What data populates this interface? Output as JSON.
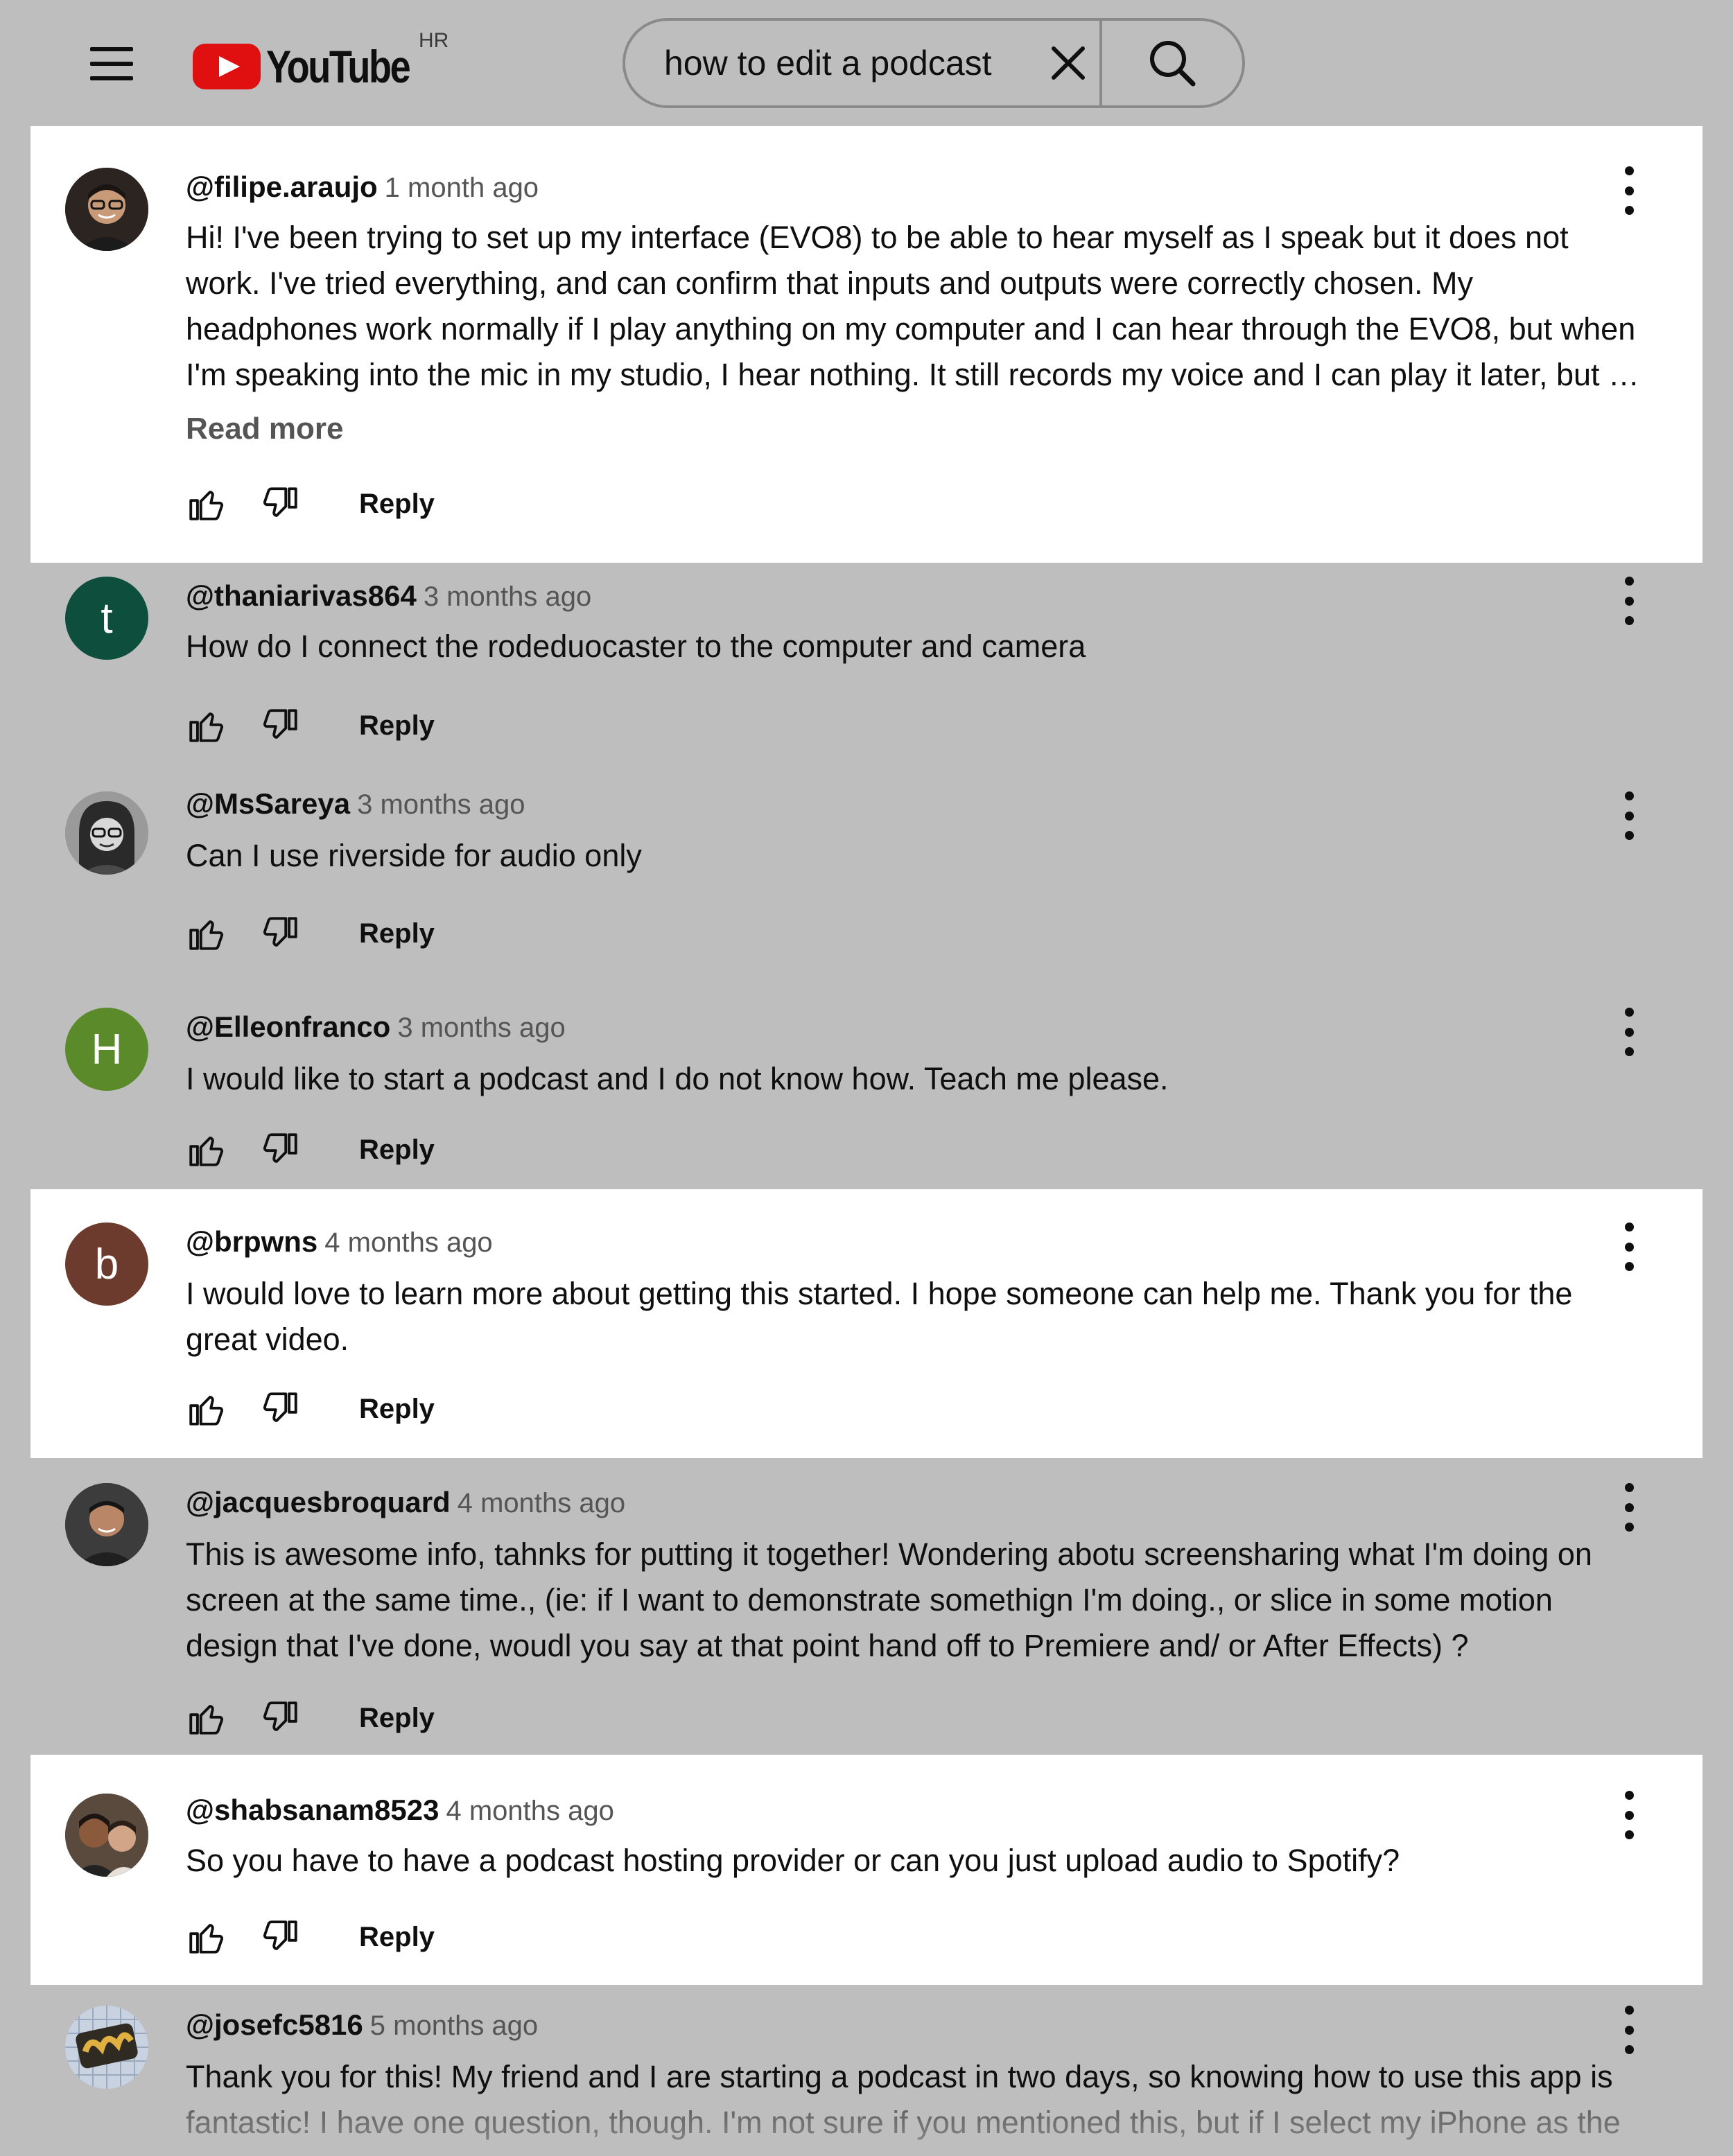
{
  "header": {
    "logo_text": "YouTube",
    "country_code": "HR",
    "search_query": "how to edit a podcast"
  },
  "comments": [
    {
      "author": "@filipe.araujo",
      "time": "1 month ago",
      "lines": [
        "Hi! I've been trying to set up my interface (EVO8) to be able to hear myself as I speak but it does not",
        "work. I've tried everything, and can confirm that inputs and outputs were correctly chosen. My",
        "headphones work normally if I play anything on my computer and I can hear through the EVO8, but when",
        "I'm speaking into the mic in my studio, I hear nothing. It still records my voice and I can play it later, but …"
      ],
      "read_more": "Read more",
      "reply": "Reply"
    },
    {
      "author": "@thaniarivas864",
      "time": "3 months ago",
      "avatar_letter": "t",
      "avatar_color": "#0d4f3c",
      "lines": [
        "How do I connect the rodeduocaster to the computer and camera"
      ],
      "reply": "Reply"
    },
    {
      "author": "@MsSareya",
      "time": "3 months ago",
      "lines": [
        "Can I use riverside for audio only"
      ],
      "reply": "Reply"
    },
    {
      "author": "@Elleonfranco",
      "time": "3 months ago",
      "avatar_letter": "H",
      "avatar_color": "#5b8a2a",
      "lines": [
        "I would like to start a podcast and I do not know how. Teach me please."
      ],
      "reply": "Reply"
    },
    {
      "author": "@brpwns",
      "time": "4 months ago",
      "avatar_letter": "b",
      "avatar_color": "#6d3b2e",
      "lines": [
        "I would love to learn more about getting this started.  I hope someone can help me.  Thank you for the",
        "great video."
      ],
      "reply": "Reply"
    },
    {
      "author": "@jacquesbroquard",
      "time": "4 months ago",
      "lines": [
        "This is awesome info, tahnks for putting it together! Wondering abotu screensharing what I'm doing on",
        "screen at the same time., (ie: if I want to demonstrate somethign I'm doing., or slice in some motion",
        "design that I've done, woudl you say at that point hand off to Premiere and/ or After Effects) ?"
      ],
      "reply": "Reply"
    },
    {
      "author": "@shabsanam8523",
      "time": "4 months ago",
      "lines": [
        "So you have to have a podcast hosting provider or can you just upload audio to Spotify?"
      ],
      "reply": "Reply"
    },
    {
      "author": "@josefc5816",
      "time": "5 months ago",
      "lines": [
        "Thank you for this! My friend and I are starting a podcast in two days, so knowing how to use this app is",
        "fantastic! I have one question, though. I'm not sure if you mentioned this, but if I select my iPhone as the"
      ]
    }
  ]
}
